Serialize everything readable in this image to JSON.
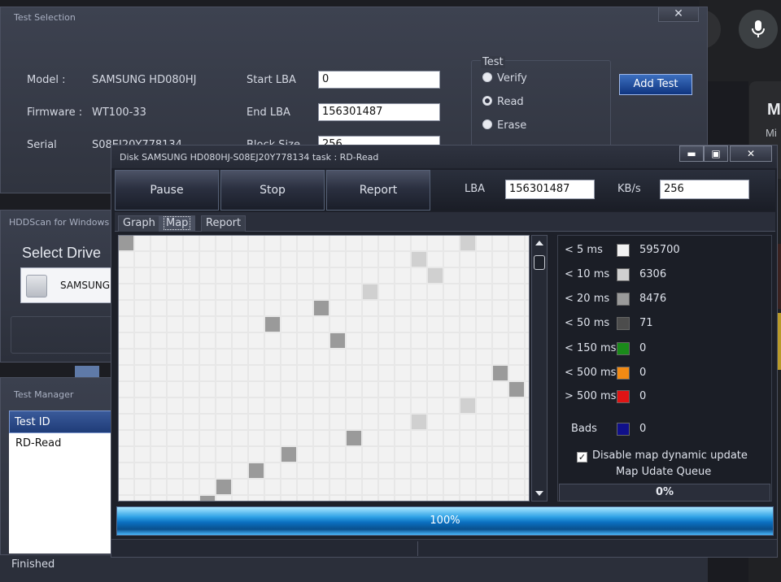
{
  "test_selection": {
    "title": "Test Selection",
    "close_label": "✕",
    "model_label": "Model :",
    "model_value": "SAMSUNG HD080HJ",
    "firmware_label": "Firmware :",
    "firmware_value": "WT100-33",
    "serial_label": "Serial",
    "serial_value": "S08EJ20Y778134",
    "start_lba_label": "Start LBA",
    "start_lba_value": "0",
    "end_lba_label": "End LBA",
    "end_lba_value": "156301487",
    "block_size_label": "Block Size",
    "block_size_value": "256",
    "test_group_label": "Test",
    "options": [
      {
        "label": "Verify",
        "selected": false
      },
      {
        "label": "Read",
        "selected": true
      },
      {
        "label": "Erase",
        "selected": false
      }
    ],
    "add_test_label": "Add Test"
  },
  "hddscan": {
    "title": "HDDScan for Windows",
    "select_drive_label": "Select Drive",
    "drive_name": "SAMSUNG"
  },
  "test_manager": {
    "title": "Test Manager",
    "column_header": "Test ID",
    "rows": [
      "RD-Read"
    ],
    "status": "Finished"
  },
  "disk_window": {
    "title": "Disk SAMSUNG HD080HJ-S08EJ20Y778134   task : RD-Read",
    "minimize_label": "▬",
    "maximize_label": "▣",
    "close_label": "✕",
    "buttons": {
      "pause": "Pause",
      "stop": "Stop",
      "report": "Report"
    },
    "lba_label": "LBA",
    "lba_value": "156301487",
    "kbs_label": "KB/s",
    "kbs_value": "256",
    "tabs": [
      "Graph",
      "Map",
      "Report"
    ],
    "active_tab": "Map",
    "legend": [
      {
        "label": "< 5 ms",
        "color": "#f2f2f2",
        "count": "595700"
      },
      {
        "label": "< 10 ms",
        "color": "#d0d0d0",
        "count": "6306"
      },
      {
        "label": "< 20 ms",
        "color": "#9a9a9a",
        "count": "8476"
      },
      {
        "label": "< 50 ms",
        "color": "#4c4c4c",
        "count": "71"
      },
      {
        "label": "< 150 ms",
        "color": "#1a8a1a",
        "count": "0"
      },
      {
        "label": "< 500 ms",
        "color": "#f28a14",
        "count": "0"
      },
      {
        "label": "> 500 ms",
        "color": "#e01414",
        "count": "0"
      },
      {
        "label": "Bads",
        "color": "#10108a",
        "count": "0"
      }
    ],
    "disable_map_label": "Disable map dynamic update",
    "disable_map_checked": true,
    "queue_label": "Map Udate Queue",
    "queue_value": "0%",
    "progress_label": "100%",
    "progress_fraction": 1.0
  },
  "background": {
    "card_letter": "M",
    "card_sub": "Mi"
  }
}
